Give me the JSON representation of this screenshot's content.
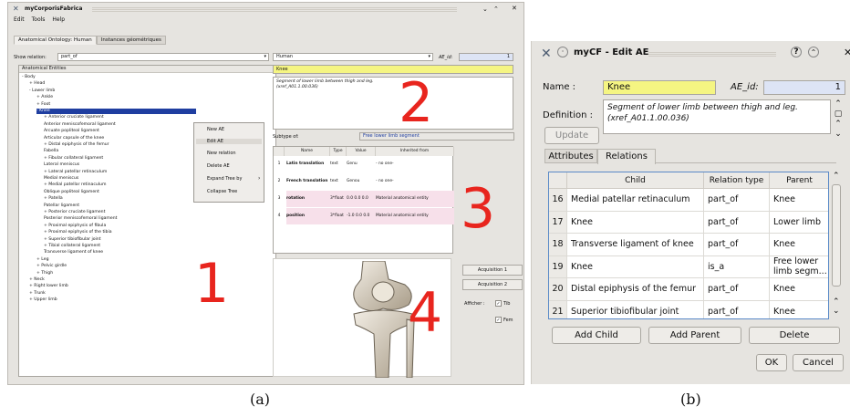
{
  "window_a": {
    "title": "myCorporisFabrica",
    "menu": [
      "Edit",
      "Tools",
      "Help"
    ],
    "tabs": [
      "Anatomical Ontology: Human",
      "Instances géométriques"
    ],
    "show_relation_label": "Show relation:",
    "show_relation_value": "part_of",
    "species_value": "Human",
    "ae_id_label": "AE_id:",
    "ae_id_value": "1",
    "tree_header": "Anatomical Entities",
    "tree": [
      {
        "label": "- Body",
        "depth": 0
      },
      {
        "label": "+ Head",
        "depth": 1
      },
      {
        "label": "- Lower limb",
        "depth": 1
      },
      {
        "label": "+ Ankle",
        "depth": 2
      },
      {
        "label": "+ Foot",
        "depth": 2
      },
      {
        "label": "- Knee",
        "depth": 2,
        "selected": true
      },
      {
        "label": "+ Anterior cruciate ligament",
        "depth": 3
      },
      {
        "label": "Anterior meniscofemoral ligament",
        "depth": 3
      },
      {
        "label": "Arcuate popliteal ligament",
        "depth": 3
      },
      {
        "label": "Articular capsule of the knee",
        "depth": 3
      },
      {
        "label": "+ Distal epiphysis of the femur",
        "depth": 3
      },
      {
        "label": "Fabella",
        "depth": 3
      },
      {
        "label": "+ Fibular collateral ligament",
        "depth": 3
      },
      {
        "label": "Lateral meniscus",
        "depth": 3
      },
      {
        "label": "+ Lateral patellar retinaculum",
        "depth": 3
      },
      {
        "label": "Medial meniscus",
        "depth": 3
      },
      {
        "label": "+ Medial patellar retinaculum",
        "depth": 3
      },
      {
        "label": "Oblique popliteal ligament",
        "depth": 3
      },
      {
        "label": "+ Patella",
        "depth": 3
      },
      {
        "label": "Patellar ligament",
        "depth": 3
      },
      {
        "label": "+ Posterior cruciate ligament",
        "depth": 3
      },
      {
        "label": "Posterior meniscofemoral ligament",
        "depth": 3
      },
      {
        "label": "+ Proximal epiphysis of fibula",
        "depth": 3
      },
      {
        "label": "+ Proximal epiphysis of the tibia",
        "depth": 3
      },
      {
        "label": "+ Superior tibiofibular joint",
        "depth": 3
      },
      {
        "label": "+ Tibial collateral ligament",
        "depth": 3
      },
      {
        "label": "Transverse ligament of knee",
        "depth": 3
      },
      {
        "label": "+ Leg",
        "depth": 2
      },
      {
        "label": "+ Pelvic girdle",
        "depth": 2
      },
      {
        "label": "+ Thigh",
        "depth": 2
      },
      {
        "label": "+ Neck",
        "depth": 1
      },
      {
        "label": "+ Right lower limb",
        "depth": 1
      },
      {
        "label": "+ Trunk",
        "depth": 1
      },
      {
        "label": "+ Upper limb",
        "depth": 1
      }
    ],
    "context_menu": [
      "New AE",
      "Edit AE",
      "New relation",
      "Delete AE",
      "Expand Tree by",
      "Collapse Tree"
    ],
    "context_menu_highlighted": 1,
    "name_value": "Knee",
    "definition": "Segment of lower limb between thigh and leg.",
    "definition_ref": "(xref_A01.1.00.036)",
    "subtype_label": "Subtype of:",
    "subtype_value": "Free lower limb segment",
    "attr_headers": [
      "Name",
      "Type",
      "Value",
      "Inherited from"
    ],
    "attributes": [
      {
        "idx": "1",
        "name": "Latin translation",
        "type": "text",
        "value": "Genu",
        "inherited": "- no one-"
      },
      {
        "idx": "2",
        "name": "French translation",
        "type": "text",
        "value": "Genou",
        "inherited": "- no one-"
      },
      {
        "idx": "3",
        "name": "rotation",
        "type": "3*float",
        "value": "0.0 0.0 0.0",
        "inherited": "Material anatomical entity"
      },
      {
        "idx": "4",
        "name": "position",
        "type": "3*float",
        "value": "-1.0 0.0 0.0",
        "inherited": "Material anatomical entity"
      }
    ],
    "acquisition_buttons": [
      "Acquisition 1",
      "Acquisition 2"
    ],
    "afficher_label": "Afficher :",
    "afficher_checks": [
      "Tib",
      "Fem"
    ],
    "region_numbers": [
      "1",
      "2",
      "3",
      "4"
    ]
  },
  "window_b": {
    "title": "myCF - Edit AE",
    "name_label": "Name :",
    "name_value": "Knee",
    "ae_id_label": "AE_id:",
    "ae_id_value": "1",
    "definition_label": "Definition :",
    "definition": "Segment of lower limb between thigh and leg.",
    "definition_ref": "(xref_A01.1.00.036)",
    "update_label": "Update",
    "tabs": [
      "Attributes",
      "Relations"
    ],
    "grid_headers": [
      "Child",
      "Relation type",
      "Parent"
    ],
    "relations": [
      {
        "idx": "16",
        "child": "Medial patellar retinaculum",
        "type": "part_of",
        "parent": "Knee"
      },
      {
        "idx": "17",
        "child": "Knee",
        "type": "part_of",
        "parent": "Lower limb"
      },
      {
        "idx": "18",
        "child": "Transverse ligament of knee",
        "type": "part_of",
        "parent": "Knee"
      },
      {
        "idx": "19",
        "child": "Knee",
        "type": "is_a",
        "parent": "Free lower limb segm..."
      },
      {
        "idx": "20",
        "child": "Distal epiphysis of the femur",
        "type": "part_of",
        "parent": "Knee"
      },
      {
        "idx": "21",
        "child": "Superior tibiofibular joint",
        "type": "part_of",
        "parent": "Knee"
      }
    ],
    "add_child_label": "Add Child",
    "add_parent_label": "Add Parent",
    "delete_label": "Delete",
    "ok_label": "OK",
    "cancel_label": "Cancel"
  },
  "captions": [
    "(a)",
    "(b)"
  ],
  "colors": {
    "highlight": "#f5f582",
    "selection": "#1f3ea0",
    "region_number": "#e8251e",
    "ae_id_field": "#dde4f5"
  }
}
